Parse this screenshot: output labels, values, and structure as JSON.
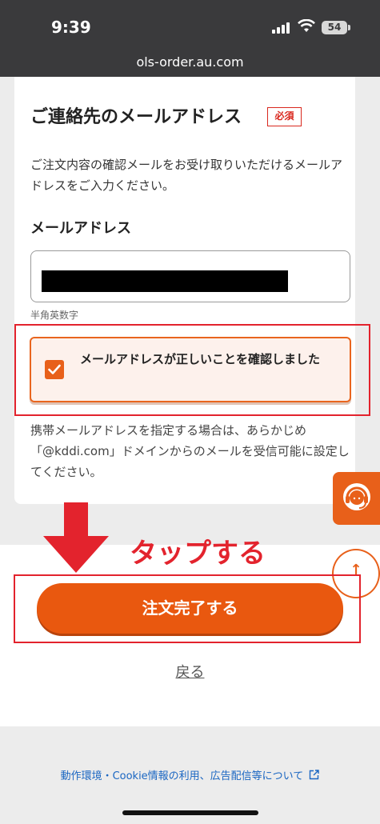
{
  "status_bar": {
    "time": "9:39",
    "battery": "54"
  },
  "browser": {
    "url": "ols-order.au.com"
  },
  "form": {
    "section_title": "ご連絡先のメールアドレス",
    "required_badge": "必須",
    "description": "ご注文内容の確認メールをお受け取りいただけるメールアドレスをご入力ください。",
    "email_label": "メールアドレス",
    "email_value": "",
    "email_hint": "半角英数字",
    "confirm_checkbox_label": "メールアドレスが正しいことを確認しました",
    "confirm_checked": true,
    "mobile_note": "携帯メールアドレスを指定する場合は、あらかじめ「@kddi.com」ドメインからのメールを受信可能に設定してください。"
  },
  "annotation": {
    "tap_label": "タップする",
    "arrow_color": "#e3232d",
    "highlight_color": "#e3232d"
  },
  "actions": {
    "complete_button": "注文完了する",
    "back_link": "戻る"
  },
  "footer": {
    "link_text": "動作環境・Cookie情報の利用、広告配信等について"
  },
  "colors": {
    "accent": "#e9580f",
    "alert": "#e3232d",
    "link": "#1a66c2"
  },
  "icons": {
    "support": "operator-headset-icon",
    "scroll_top": "arrow-up-icon",
    "external": "external-link-icon",
    "checkmark": "check-icon"
  }
}
